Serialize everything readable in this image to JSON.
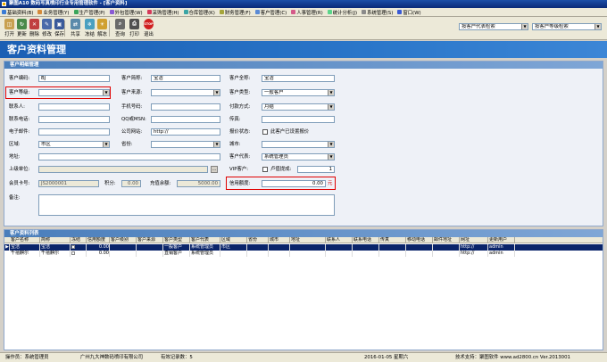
{
  "window": {
    "title": "聚图A10 数码写真喷印行业专用管理软件 - [客户资料]"
  },
  "menu": [
    {
      "label": "基础资料(B)",
      "color": "#3a7bd5"
    },
    {
      "label": "业务管理(Y)",
      "color": "#d58a3a"
    },
    {
      "label": "生产管理(P)",
      "color": "#3aa55a"
    },
    {
      "label": "外包管理(W)",
      "color": "#8a5ad5"
    },
    {
      "label": "采购管理(H)",
      "color": "#d53a5a"
    },
    {
      "label": "仓库管理(K)",
      "color": "#3aa5a5"
    },
    {
      "label": "财务管理(F)",
      "color": "#a5a53a"
    },
    {
      "label": "客户管理(C)",
      "color": "#5a8ad5"
    },
    {
      "label": "人事管理(R)",
      "color": "#d55a8a"
    },
    {
      "label": "统计分析(J)",
      "color": "#5ad58a"
    },
    {
      "label": "系统管理(S)",
      "color": "#8a8a8a"
    },
    {
      "label": "窗口(W)",
      "color": "#3a5ad5"
    }
  ],
  "toolbar": {
    "buttons": [
      {
        "label": "打开",
        "icon": "open-icon",
        "glyph": "◫",
        "color": "#c8a050"
      },
      {
        "label": "更新",
        "icon": "refresh-icon",
        "glyph": "↻",
        "color": "#4a8a4a"
      },
      {
        "label": "删除",
        "icon": "delete-icon",
        "glyph": "✕",
        "color": "#c04040"
      },
      {
        "label": "修改",
        "icon": "edit-icon",
        "glyph": "✎",
        "color": "#4a6aaa"
      },
      {
        "label": "保存",
        "icon": "save-icon",
        "glyph": "▣",
        "color": "#3a5a9a"
      },
      {
        "label": "共享",
        "icon": "share-icon",
        "glyph": "⇄",
        "color": "#5a8aaa"
      },
      {
        "label": "冻结",
        "icon": "freeze-icon",
        "glyph": "❄",
        "color": "#4aa0c0"
      },
      {
        "label": "解冻",
        "icon": "unfreeze-icon",
        "glyph": "☀",
        "color": "#d0a030"
      },
      {
        "label": "查询",
        "icon": "search-icon",
        "glyph": "⌕",
        "color": "#6a6a6a"
      },
      {
        "label": "打印",
        "icon": "print-icon",
        "glyph": "⎙",
        "color": "#505050"
      },
      {
        "label": "退出",
        "icon": "stop-icon",
        "glyph": "STOP",
        "color": "#d02020"
      }
    ],
    "search_field": "按客户代表检索",
    "sort_field": "按客户等级检索"
  },
  "banner": {
    "title": "客户资料管理"
  },
  "detail": {
    "section_title": "客户明细管理",
    "fields": {
      "code_label": "客户编码:",
      "code_value": "BJ",
      "short_label": "客户简称:",
      "short_value": "宝洁",
      "full_label": "客户全称:",
      "full_value": "宝洁",
      "level_label": "客户等级:",
      "level_value": "",
      "source_label": "客户来源:",
      "source_value": "",
      "type_label": "客户类型:",
      "type_value": "一般客户",
      "contact_label": "联系人:",
      "contact_value": "",
      "mobile_label": "手机号码:",
      "mobile_value": "",
      "pay_label": "付款方式:",
      "pay_value": "月结",
      "phone_label": "联系电话:",
      "phone_value": "",
      "qq_label": "QQ或MSN:",
      "qq_value": "",
      "fax_label": "传真:",
      "fax_value": "",
      "email_label": "电子邮件:",
      "email_value": "",
      "web_label": "公司网站:",
      "web_value": "http://",
      "quote_label": "报价状态:",
      "quote_check_label": "此客户已设置报价",
      "area_label": "区域:",
      "area_value": "市区",
      "province_label": "省份:",
      "province_value": "",
      "city_label": "城市:",
      "city_value": "",
      "address_label": "地址:",
      "address_value": "",
      "rep_label": "客户代表:",
      "rep_value": "系统管理员",
      "parent_label": "上级单位:",
      "parent_value": "",
      "vip_label": "VIP客户:",
      "vip_check_label": "卢值提成:",
      "vip_value": "1",
      "card_label": "会员卡号:",
      "card_value": "JS2000001",
      "points_label": "积分:",
      "points_value": "0.00",
      "prepay_label": "充值余额:",
      "prepay_value": "5000.00",
      "credit_label": "信用额度:",
      "credit_value": "0.00",
      "credit_unit": "元",
      "remark_label": "备注:",
      "remark_value": ""
    }
  },
  "list": {
    "section_title": "客户资料列表",
    "columns": [
      "客户名称",
      "简称",
      "冻结",
      "信用额度",
      "客户级别",
      "客户来源",
      "客户类型",
      "客户代表",
      "区域",
      "省份",
      "城市",
      "地址",
      "联系人",
      "联系电话",
      "传真",
      "移动电话",
      "邮件地址",
      "网址",
      "更新用户"
    ],
    "rows": [
      [
        "宝洁",
        "宝洁",
        "",
        "0.00",
        "",
        "",
        "一般客户",
        "系统管理员",
        "市区",
        "",
        "",
        "",
        "",
        "",
        "",
        "",
        "",
        "http://",
        "admin"
      ],
      [
        "千禧麒尔",
        "千禧麒尔",
        "",
        "0.00",
        "",
        "",
        "直销客户",
        "系统管理员",
        "",
        "",
        "",
        "",
        "",
        "",
        "",
        "",
        "",
        "http://",
        "admin"
      ]
    ]
  },
  "status": {
    "operator": "操作员：系统管理员",
    "company": "广州九大神数码喷印有限公司",
    "records": "有效记录数：5",
    "date": "2016-01-05 星期六",
    "support": "技术支持：聚图软件 www.ad2800.cn Ver.2013001"
  }
}
